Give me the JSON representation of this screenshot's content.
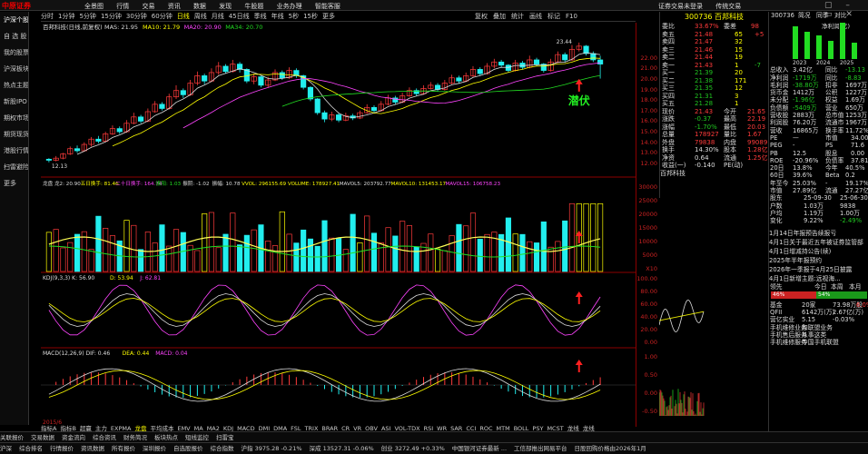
{
  "topbar": {
    "logo": "中原证券",
    "menu": [
      "全景图",
      "行情",
      "交易",
      "资讯",
      "数据",
      "发现",
      "牛股题",
      "业务办理",
      "智能客服"
    ],
    "right": [
      "证券交易未登录",
      "传统交易"
    ],
    "window_ctrls": "▢ – ▭ ✕"
  },
  "sidebar": [
    "沪深个股",
    "自 选 股",
    "我的股票",
    "沪深板块",
    "热点主题",
    "新股IPO",
    "期权市场",
    "期货现货",
    "港股行情",
    "扫雷避险",
    "更多"
  ],
  "periods": [
    "分时",
    "1分钟",
    "5分钟",
    "15分钟",
    "30分钟",
    "60分钟",
    "日线",
    "周线",
    "月线",
    "45日线",
    "季线",
    "年线",
    "5秒",
    "15秒",
    "更多"
  ],
  "active_period": "日线",
  "toolbar2": [
    "复权",
    "叠加",
    "统计",
    "画线",
    "标记",
    "F10"
  ],
  "main_chart": {
    "title": "百邦科技(日线,前复权)",
    "ma_legend": [
      {
        "label": "MAS: 21.95",
        "color": "#dddddd"
      },
      {
        "label": "MA10: 21.79",
        "color": "#ffff00"
      },
      {
        "label": "MA20: 20.90",
        "color": "#ff44ff"
      },
      {
        "label": "MA34: 20.70",
        "color": "#22dd22"
      }
    ],
    "high_label": "23.44",
    "low_label": "12.13",
    "annotation": "潜伏",
    "price_ticks": [
      "22.00",
      "21.00",
      "20.00",
      "19.00",
      "18.00",
      "17.00",
      "16.00",
      "15.00",
      "14.00",
      "13.00",
      "12.00"
    ]
  },
  "vol_panel": {
    "legend": [
      {
        "label": "龙盘 龙2: 20.90",
        "color": "#ddd"
      },
      {
        "label": "五日换手: 81.46",
        "color": "#ff0"
      },
      {
        "label": "二十日换手: 164.74",
        "color": "#ff44ff"
      },
      {
        "label": "振阳: 1.03",
        "color": "#22dd22"
      },
      {
        "label": "振阴: -1.02",
        "color": "#ddd"
      },
      {
        "label": "振幅: 10.78",
        "color": "#ddd"
      },
      {
        "label": "VVOL: 296155.69",
        "color": "#ff0"
      },
      {
        "label": "VOLUME: 178927.41",
        "color": "#ff0"
      },
      {
        "label": "MAVOL5: 203792.77",
        "color": "#ddd"
      },
      {
        "label": "MAVOL10: 131453.17",
        "color": "#ff0"
      },
      {
        "label": "MAVOL15: 106758.23",
        "color": "#ff44ff"
      }
    ],
    "ticks": [
      "30000",
      "25000",
      "20000",
      "15000",
      "10000",
      "5000",
      "X10"
    ]
  },
  "kdj_panel": {
    "legend": [
      {
        "label": "KDJ(9,3,3)  K: 56.90",
        "color": "#ddd"
      },
      {
        "label": "D: 53.94",
        "color": "#ff0"
      },
      {
        "label": "J: 62.81",
        "color": "#ff44ff"
      }
    ],
    "ticks": [
      "100.00",
      "80.00",
      "60.00",
      "40.00",
      "20.00",
      "0.00"
    ]
  },
  "macd_panel": {
    "legend": [
      {
        "label": "MACD(12,26,9)  DIF: 0.46",
        "color": "#ddd"
      },
      {
        "label": "DEA: 0.44",
        "color": "#ff0"
      },
      {
        "label": "MACD: 0.04",
        "color": "#ff44ff"
      }
    ],
    "ticks": [
      "1.00",
      "0.50",
      "0.00",
      "-0.50"
    ]
  },
  "quote": {
    "code_name": "300736 百邦科技",
    "weibi_label": "委比",
    "weibi": "33.67%",
    "weicha_label": "委差",
    "weicha": "98",
    "sells": [
      {
        "l": "卖五",
        "p": "21.48",
        "v": "65",
        "c": "+5"
      },
      {
        "l": "卖四",
        "p": "21.47",
        "v": "32",
        "c": ""
      },
      {
        "l": "卖三",
        "p": "21.46",
        "v": "15",
        "c": ""
      },
      {
        "l": "卖二",
        "p": "21.44",
        "v": "19",
        "c": ""
      },
      {
        "l": "卖一",
        "p": "21.43",
        "v": "1",
        "c": "-7"
      }
    ],
    "buys": [
      {
        "l": "买一",
        "p": "21.39",
        "v": "20"
      },
      {
        "l": "买二",
        "p": "21.38",
        "v": "171"
      },
      {
        "l": "买三",
        "p": "21.35",
        "v": "12"
      },
      {
        "l": "买四",
        "p": "21.31",
        "v": "3"
      },
      {
        "l": "买五",
        "p": "21.28",
        "v": "1"
      }
    ],
    "stats": [
      {
        "a": "现价",
        "av": "21.43",
        "b": "今开",
        "bv": "21.65"
      },
      {
        "a": "涨跌",
        "av": "-0.37",
        "b": "最高",
        "bv": "22.19"
      },
      {
        "a": "涨幅",
        "av": "-1.70%",
        "b": "最低",
        "bv": "20.03"
      },
      {
        "a": "总量",
        "av": "178927",
        "b": "量比",
        "bv": "1.67"
      },
      {
        "a": "外盘",
        "av": "79838",
        "b": "内盘",
        "bv": "99089"
      },
      {
        "a": "换手",
        "av": "14.30%",
        "b": "股本",
        "bv": "1.28亿"
      },
      {
        "a": "净资",
        "av": "0.64",
        "b": "流通",
        "bv": "1.25亿"
      },
      {
        "a": "收益(一)",
        "av": "-0.140",
        "b": "PE(动)",
        "bv": ""
      }
    ],
    "sub_name": "百邦科技"
  },
  "profile": {
    "code": "300736",
    "tabs": [
      "简况",
      "同季",
      "对比"
    ],
    "net_label": "净利润(亿)",
    "years": [
      "2023",
      "2024",
      "2025"
    ],
    "rows": [
      {
        "a": "总收入",
        "av": "3.42亿",
        "b": "同比",
        "bv": "-13.13"
      },
      {
        "a": "净利润",
        "av": "-1719万",
        "b": "同比",
        "bv": "-8.83"
      },
      {
        "a": "毛利润",
        "av": "-38.80万",
        "b": "扣非",
        "bv": "1697万"
      },
      {
        "a": "货币金",
        "av": "1412万",
        "b": "公积",
        "bv": "1227万"
      },
      {
        "a": "未分配",
        "av": "-1.96亿",
        "b": "权益",
        "bv": "1.69万"
      },
      {
        "a": "负债额",
        "av": "-5409万",
        "b": "营业",
        "bv": "650万"
      },
      {
        "a": "营收股",
        "av": "2883万",
        "b": "总市值",
        "bv": "1253万"
      },
      {
        "a": "利润股",
        "av": "76.20万",
        "b": "流通市",
        "bv": "1967万"
      },
      {
        "a": "营收",
        "av": "16865万",
        "b": "换手率",
        "bv": "11.72%"
      }
    ],
    "val_rows": [
      {
        "a": "PE",
        "av": "—",
        "b": "市值",
        "bv": "34.00"
      },
      {
        "a": "PEG",
        "av": "-",
        "b": "PS",
        "bv": "71.6"
      },
      {
        "a": "PB",
        "av": "12.5",
        "b": "股息",
        "bv": "0.00"
      },
      {
        "a": "ROE",
        "av": "-20.96%",
        "b": "负债率",
        "bv": "37.81"
      }
    ],
    "perf_rows": [
      {
        "a": "20日",
        "av": "13.8%",
        "b": "今年",
        "bv": "40.5%"
      },
      {
        "a": "60日",
        "av": "39.6%",
        "b": "Beta",
        "bv": "0.2"
      },
      {
        "a": "年至今",
        "av": "25.03%",
        "b": "-",
        "bv": "19.17%"
      },
      {
        "a": "市值",
        "av": "27.89亿",
        "b": "流通",
        "bv": "27.27亿"
      }
    ],
    "holder_hdr": {
      "a": "股东",
      "b": "25-09-30",
      "c": "25-06-30"
    },
    "holder_rows": [
      {
        "a": "户数",
        "b": "1.03万",
        "c": "9838"
      },
      {
        "a": "户均",
        "b": "1.19万",
        "c": "1.00万"
      },
      {
        "a": "变化",
        "b": "9.22%",
        "c": "-2.49%"
      }
    ]
  },
  "news": [
    "1月14日年报预告续报亏",
    "4月1日关于最近五年被证券监管部",
    "4月1日增减持公告(续)",
    "2025年半年报预约",
    "2026年一季报于4月25日披露",
    "4月1日新增主题:远视海..."
  ],
  "bottom_right": {
    "lingxian": "领先",
    "today": "今日",
    "benzhou": "本周",
    "benyue": "本月",
    "zhangfu": "7人",
    "up_pct": "46%",
    "down_pct": "54%",
    "y8": "8人",
    "rows": [
      {
        "a": "基金",
        "b": "20家",
        "c": "73.98万股",
        "d": "6.0%"
      },
      {
        "a": "QFII",
        "b": "6142万(万)",
        "c": "2.67亿(万)",
        "d": ""
      },
      {
        "a": "营亿实业",
        "b": "5.15",
        "c": "-0.03%",
        "d": ""
      },
      {
        "a": "手机维修业务",
        "b": "和联盟业务",
        "c": "",
        "d": ""
      },
      {
        "a": "手机售后服务",
        "b": "从事这类",
        "c": "",
        "d": ""
      },
      {
        "a": "手机维修服务",
        "b": "中国手机联盟",
        "c": "",
        "d": ""
      }
    ]
  },
  "indicators": [
    "指标A",
    "指标B",
    "超赢",
    "主力",
    "EXPMA",
    "龙盘",
    "平均成本",
    "EMV",
    "MA",
    "MA2",
    "KDJ",
    "MACD",
    "DMI",
    "DMA",
    "FSL",
    "TRIX",
    "BRAR",
    "CR",
    "VR",
    "OBV",
    "ASI",
    "VOL-TDX",
    "RSI",
    "WR",
    "SAR",
    "CCI",
    "ROC",
    "MTM",
    "BOLL",
    "PSY",
    "MCST",
    "龙线",
    "龙线"
  ],
  "active_indicator": "龙盘",
  "bottom1": [
    "关联报价",
    "交易数据",
    "资金流向",
    "综合资讯",
    "财务简况",
    "板块热点",
    "短线监控",
    "扫雷宝",
    "",
    ""
  ],
  "bottom2": [
    "沪深",
    "综合排名",
    "行情报价",
    "资讯数据",
    "所有报价",
    "深圳报价",
    "自选股报价",
    "综合指数",
    "沪指 3975.28 -0.21%",
    "深成 13527.31 -0.06%",
    "创业 3272.49 +0.33%",
    "中国银河证券最新 ...",
    "工信部推出网易平台",
    "日股回购价格由2026年1月"
  ],
  "x_label": "2015/6",
  "colors": {
    "up": "#ff3b3b",
    "down": "#22eeee",
    "ma5": "#dddddd",
    "ma10": "#ffff00",
    "ma20": "#ff44ff",
    "ma34": "#22dd22"
  },
  "chart_data": {
    "type": "candlestick",
    "title": "百邦科技(日线,前复权)",
    "candles": [
      [
        12.4,
        12.3,
        12.5,
        12.1
      ],
      [
        12.3,
        12.5,
        12.7,
        12.2
      ],
      [
        12.5,
        12.9,
        13.0,
        12.4
      ],
      [
        12.9,
        13.4,
        13.6,
        12.8
      ],
      [
        13.4,
        13.2,
        13.7,
        13.0
      ],
      [
        13.2,
        13.8,
        14.0,
        13.1
      ],
      [
        13.8,
        14.3,
        14.5,
        13.6
      ],
      [
        14.3,
        14.1,
        14.6,
        13.9
      ],
      [
        14.1,
        14.8,
        15.0,
        14.0
      ],
      [
        14.8,
        15.3,
        15.6,
        14.7
      ],
      [
        15.3,
        15.0,
        15.5,
        14.8
      ],
      [
        15.0,
        15.8,
        16.1,
        14.9
      ],
      [
        15.8,
        16.4,
        16.8,
        15.7
      ],
      [
        16.4,
        16.0,
        16.6,
        15.8
      ],
      [
        16.0,
        16.9,
        17.2,
        15.9
      ],
      [
        16.9,
        17.6,
        17.9,
        16.8
      ],
      [
        17.6,
        17.2,
        17.8,
        17.0
      ],
      [
        17.2,
        18.3,
        18.6,
        17.1
      ],
      [
        18.3,
        18.9,
        19.4,
        18.1
      ],
      [
        18.9,
        18.5,
        19.1,
        18.2
      ],
      [
        18.5,
        19.6,
        19.9,
        18.4
      ],
      [
        19.6,
        20.3,
        20.7,
        19.4
      ],
      [
        20.3,
        19.8,
        20.5,
        19.5
      ],
      [
        19.8,
        20.6,
        21.0,
        19.7
      ],
      [
        20.6,
        21.2,
        21.6,
        20.4
      ],
      [
        21.2,
        20.7,
        21.4,
        20.5
      ],
      [
        20.7,
        21.4,
        21.8,
        20.6
      ],
      [
        21.4,
        20.9,
        21.6,
        20.6
      ],
      [
        20.9,
        19.8,
        21.0,
        19.6
      ],
      [
        19.8,
        20.2,
        20.5,
        19.5
      ],
      [
        20.2,
        19.4,
        20.3,
        19.2
      ],
      [
        19.4,
        19.9,
        20.2,
        19.2
      ],
      [
        19.9,
        20.6,
        20.9,
        19.8
      ],
      [
        20.6,
        20.1,
        20.8,
        19.9
      ],
      [
        20.1,
        20.8,
        21.1,
        20.0
      ],
      [
        20.8,
        20.3,
        21.0,
        20.1
      ],
      [
        20.3,
        19.2,
        20.4,
        19.0
      ],
      [
        19.2,
        18.1,
        19.3,
        17.9
      ],
      [
        18.1,
        16.8,
        18.2,
        16.6
      ],
      [
        16.8,
        16.2,
        17.0,
        15.9
      ],
      [
        16.2,
        16.6,
        16.9,
        16.0
      ],
      [
        16.6,
        16.1,
        16.8,
        15.9
      ],
      [
        16.1,
        16.5,
        16.8,
        16.0
      ],
      [
        16.5,
        16.3,
        16.7,
        16.1
      ],
      [
        16.3,
        16.8,
        17.0,
        16.2
      ],
      [
        16.8,
        17.3,
        17.6,
        16.7
      ],
      [
        17.3,
        17.0,
        17.5,
        16.8
      ],
      [
        17.0,
        17.6,
        17.9,
        16.9
      ],
      [
        17.6,
        18.2,
        18.5,
        17.5
      ],
      [
        18.2,
        17.8,
        18.4,
        17.6
      ],
      [
        17.8,
        18.4,
        18.7,
        17.7
      ],
      [
        18.4,
        18.9,
        19.2,
        18.3
      ],
      [
        18.9,
        18.6,
        19.1,
        18.4
      ],
      [
        18.6,
        19.1,
        19.4,
        18.5
      ],
      [
        19.1,
        19.4,
        19.7,
        19.0
      ],
      [
        19.4,
        19.0,
        19.6,
        18.8
      ],
      [
        19.0,
        19.6,
        19.9,
        18.9
      ],
      [
        19.6,
        20.1,
        20.4,
        19.5
      ],
      [
        20.1,
        19.8,
        20.3,
        19.6
      ],
      [
        19.8,
        20.3,
        20.6,
        19.7
      ],
      [
        20.3,
        20.9,
        21.2,
        20.2
      ],
      [
        20.9,
        20.5,
        21.1,
        20.3
      ],
      [
        20.5,
        21.2,
        21.5,
        20.4
      ],
      [
        21.2,
        21.6,
        21.9,
        21.0
      ],
      [
        21.6,
        21.3,
        21.8,
        21.1
      ],
      [
        21.3,
        20.8,
        21.4,
        20.6
      ],
      [
        20.8,
        21.5,
        21.8,
        20.7
      ],
      [
        21.5,
        21.1,
        21.7,
        20.9
      ],
      [
        21.1,
        21.8,
        22.2,
        21.0
      ],
      [
        21.8,
        21.4,
        22.0,
        21.2
      ],
      [
        21.4,
        20.8,
        21.5,
        20.6
      ],
      [
        20.8,
        21.6,
        21.9,
        20.7
      ],
      [
        21.6,
        22.3,
        22.6,
        21.5
      ],
      [
        22.3,
        21.8,
        22.5,
        21.6
      ],
      [
        21.8,
        22.8,
        23.2,
        21.7
      ],
      [
        22.8,
        23.1,
        23.44,
        22.6
      ],
      [
        23.1,
        22.4,
        23.2,
        22.2
      ],
      [
        22.4,
        21.8,
        22.6,
        21.6
      ],
      [
        21.8,
        21.4,
        22.19,
        20.03
      ]
    ],
    "ylim": [
      12,
      23.6
    ]
  }
}
